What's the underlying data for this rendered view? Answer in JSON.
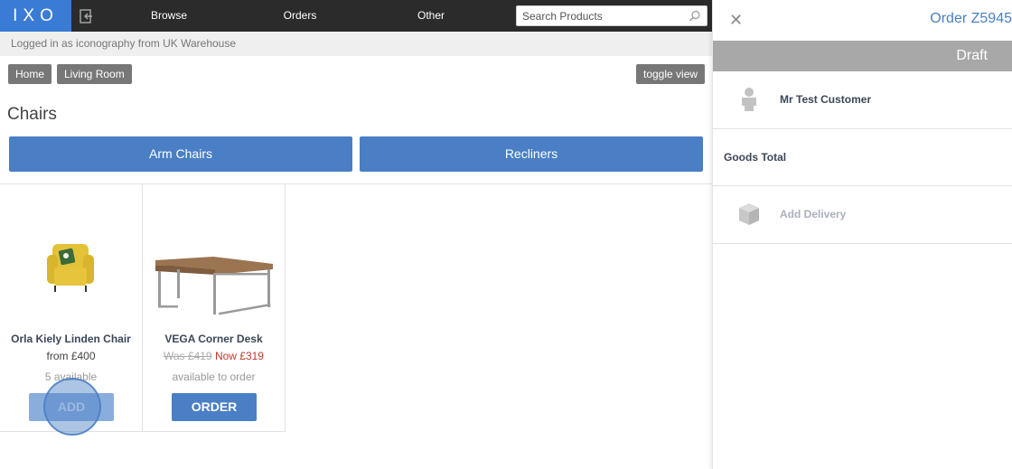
{
  "nav": {
    "logo": "IXO",
    "links": [
      "Browse",
      "Orders",
      "Other"
    ],
    "search_placeholder": "Search Products"
  },
  "logged_in_text": "Logged in as iconography from UK Warehouse",
  "breadcrumbs": [
    "Home",
    "Living Room"
  ],
  "toggle_view_label": "toggle view",
  "page_title": "Chairs",
  "categories": [
    "Arm Chairs",
    "Recliners"
  ],
  "products": [
    {
      "name": "Orla Kiely Linden Chair",
      "price": "from £400",
      "availability": "5 available",
      "button": "ADD",
      "image": "yellow-armchair-image"
    },
    {
      "name": "VEGA Corner Desk",
      "was_price": "Was £419",
      "now_price": "Now £319",
      "availability": "available to order",
      "button": "ORDER",
      "image": "corner-desk-image"
    }
  ],
  "order_panel": {
    "close_icon": "close-icon",
    "title": "Order Z5945",
    "status": "Draft",
    "customer": "Mr Test Customer",
    "goods_total_label": "Goods Total",
    "add_delivery_label": "Add Delivery"
  },
  "colors": {
    "brand_blue": "#3a7bd5",
    "button_blue": "#4a7fc5",
    "nav_dark": "#2b2b2b",
    "sale_red": "#c0392b",
    "status_grey": "#a8a8a8"
  }
}
